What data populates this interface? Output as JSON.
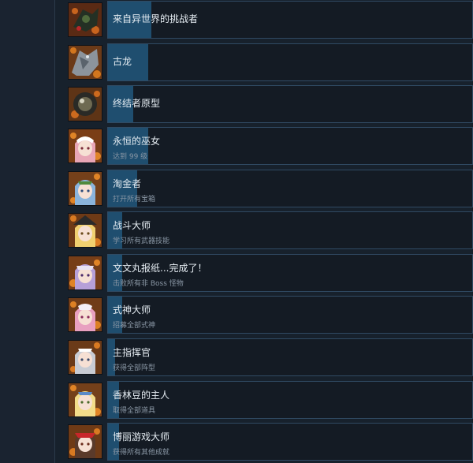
{
  "achievements": [
    {
      "title": "来自异世界的挑战者",
      "desc": "",
      "progress": 0.12,
      "icon": "monster-dark-icon"
    },
    {
      "title": "古龙",
      "desc": "",
      "progress": 0.11,
      "icon": "dragon-icon"
    },
    {
      "title": "终结者原型",
      "desc": "",
      "progress": 0.07,
      "icon": "robot-orb-icon"
    },
    {
      "title": "永恒的巫女",
      "desc": "达到 99 级",
      "progress": 0.11,
      "icon": "shrine-maiden-icon"
    },
    {
      "title": "淘金者",
      "desc": "打开所有宝箱",
      "progress": 0.08,
      "icon": "blue-hair-girl-icon"
    },
    {
      "title": "战斗大师",
      "desc": "学习所有武器技能",
      "progress": 0.04,
      "icon": "blonde-witch-icon"
    },
    {
      "title": "文文丸报纸...完成了！",
      "desc": "击败所有非 Boss 怪物",
      "progress": 0.04,
      "icon": "purple-hair-girl-icon"
    },
    {
      "title": "式神大师",
      "desc": "招募全部式神",
      "progress": 0.04,
      "icon": "pink-hair-girl-icon"
    },
    {
      "title": "主指挥官",
      "desc": "获得全部阵型",
      "progress": 0.02,
      "icon": "silver-hair-maid-icon"
    },
    {
      "title": "香林豆的主人",
      "desc": "取得全部道具",
      "progress": 0.03,
      "icon": "blonde-girl-icon"
    },
    {
      "title": "博丽游戏大师",
      "desc": "获得所有其他成就",
      "progress": 0.03,
      "icon": "red-shrine-maiden-icon"
    }
  ],
  "colors": {
    "progress_fill": "#1f4e6f",
    "card_border": "#304a63",
    "title": "#e6edf3",
    "desc": "#8a97a5"
  }
}
